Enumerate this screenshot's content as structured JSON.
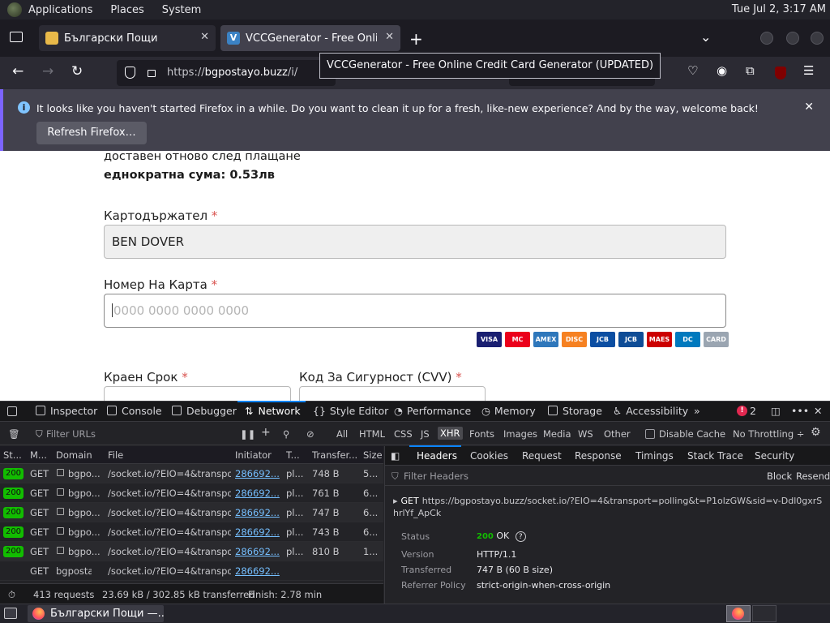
{
  "system_bar": {
    "menus": [
      "Applications",
      "Places",
      "System"
    ],
    "clock": "Tue Jul  2,  3:17 AM"
  },
  "tabs": [
    {
      "title": "Български Пощи",
      "active": false
    },
    {
      "title": "VCCGenerator - Free Online",
      "active": true
    }
  ],
  "nav": {
    "url_scheme": "https://",
    "url_host": "bgpostayo.buzz",
    "url_path": "/i/"
  },
  "tooltip": "VCCGenerator - Free Online Credit Card Generator (UPDATED)",
  "notification": {
    "message": "It looks like you haven't started Firefox in a while. Do you want to clean it up for a fresh, like-new experience? And by the way, welcome back!",
    "button": "Refresh Firefox…"
  },
  "page": {
    "line1": "доставен отново след плащане",
    "line2": "еднократна сума: 0.53лв",
    "cardholder_label": "Картодържател",
    "cardholder_value": "BEN DOVER",
    "card_number_label": "Номер На Карта",
    "card_number_placeholder": "0000 0000 0000 0000",
    "expiry_label": "Краен Срок",
    "cvv_label": "Код За Сигурност (CVV)",
    "required_mark": "*",
    "card_brands": [
      {
        "text": "VISA",
        "color": "#1a1f71"
      },
      {
        "text": "MC",
        "color": "#eb001b"
      },
      {
        "text": "AMEX",
        "color": "#2e77bb"
      },
      {
        "text": "DISC",
        "color": "#f68121"
      },
      {
        "text": "JCB",
        "color": "#0b4ea2"
      },
      {
        "text": "JCB",
        "color": "#0e4c96"
      },
      {
        "text": "MAES",
        "color": "#cc0000"
      },
      {
        "text": "DC",
        "color": "#0079be"
      },
      {
        "text": "CARD",
        "color": "#9aa5b1"
      }
    ]
  },
  "devtools": {
    "tabs": [
      "Inspector",
      "Console",
      "Debugger",
      "Network",
      "Style Editor",
      "Performance",
      "Memory",
      "Storage",
      "Accessibility"
    ],
    "active_tab": "Network",
    "error_count": "2",
    "filter_placeholder": "Filter URLs",
    "types": [
      "All",
      "HTML",
      "CSS",
      "JS",
      "XHR",
      "Fonts",
      "Images",
      "Media",
      "WS",
      "Other"
    ],
    "selected_type": "XHR",
    "disable_cache": "Disable Cache",
    "throttling": "No Throttling ÷",
    "columns": [
      "St...",
      "M...",
      "Domain",
      "File",
      "Initiator",
      "T...",
      "Transfer...",
      "Size"
    ],
    "rows": [
      {
        "status": "200",
        "method": "GET",
        "domain": "bgpo...",
        "file": "/socket.io/?EIO=4&transport=p",
        "initiator": "286692...",
        "type": "pl...",
        "transfer": "748 B",
        "size": "5..."
      },
      {
        "status": "200",
        "method": "GET",
        "domain": "bgpo...",
        "file": "/socket.io/?EIO=4&transport=p",
        "initiator": "286692...",
        "type": "pl...",
        "transfer": "761 B",
        "size": "6..."
      },
      {
        "status": "200",
        "method": "GET",
        "domain": "bgpo...",
        "file": "/socket.io/?EIO=4&transport=p",
        "initiator": "286692...",
        "type": "pl...",
        "transfer": "747 B",
        "size": "6..."
      },
      {
        "status": "200",
        "method": "GET",
        "domain": "bgpo...",
        "file": "/socket.io/?EIO=4&transport=p",
        "initiator": "286692...",
        "type": "pl...",
        "transfer": "743 B",
        "size": "6..."
      },
      {
        "status": "200",
        "method": "GET",
        "domain": "bgpo...",
        "file": "/socket.io/?EIO=4&transport=p",
        "initiator": "286692...",
        "type": "pl...",
        "transfer": "810 B",
        "size": "1..."
      },
      {
        "status": "",
        "method": "GET",
        "domain": "bgposta...",
        "file": "/socket.io/?EIO=4&transport=p",
        "initiator": "286692...",
        "type": "",
        "transfer": "",
        "size": ""
      }
    ],
    "summary": {
      "requests": "413 requests",
      "transferred": "23.69 kB / 302.85 kB transferred",
      "finish": "Finish: 2.78 min"
    },
    "detail_tabs": [
      "Headers",
      "Cookies",
      "Request",
      "Response",
      "Timings",
      "Stack Trace",
      "Security"
    ],
    "detail_active": "Headers",
    "filter_headers": "Filter Headers",
    "block": "Block",
    "resend": "Resend",
    "request_method": "GET",
    "request_url": "https://bgpostayo.buzz/socket.io/?EIO=4&transport=polling&t=P1olzGW&sid=v-Ddl0gxrShrlYf_ApCk",
    "status_label": "Status",
    "status_code": "200",
    "status_text": "OK",
    "version_label": "Version",
    "version": "HTTP/1.1",
    "transferred_label": "Transferred",
    "transferred": "747 B (60 B size)",
    "referrer_label": "Referrer Policy",
    "referrer": "strict-origin-when-cross-origin"
  },
  "taskbar": {
    "window_title": "Български Пощи —..."
  }
}
